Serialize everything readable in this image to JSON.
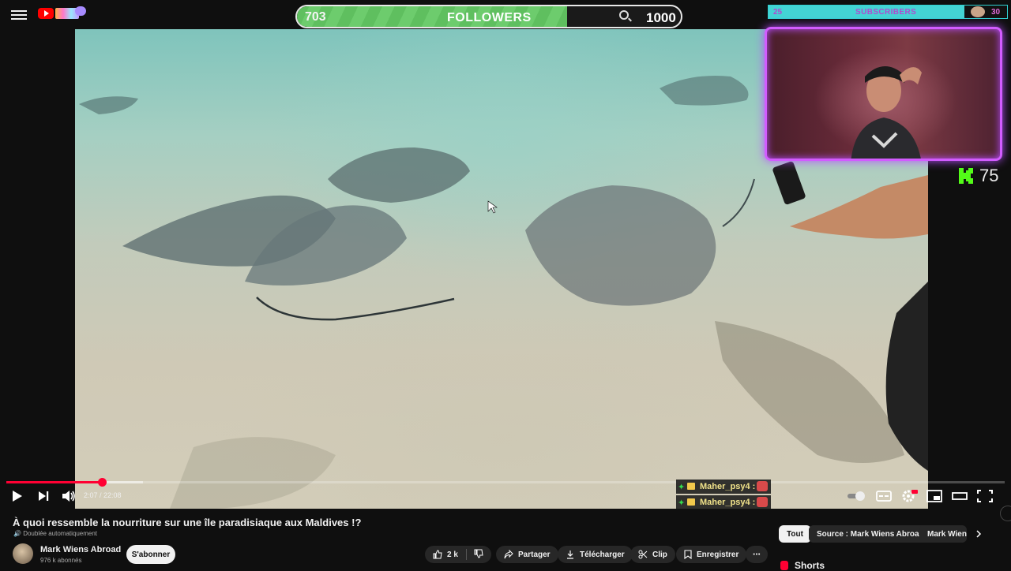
{
  "overlay": {
    "followers_current": "703",
    "followers_label": "FOLLOWERS",
    "followers_goal": "1000",
    "followers_progress_fraction": 0.703,
    "subscribers_current": "25",
    "subscribers_label": "SUBSCRIBERS",
    "subscribers_goal": "30",
    "kick_count": "75"
  },
  "player": {
    "time": "2:07 / 22:08",
    "progress_fraction": 0.096
  },
  "chat": [
    {
      "user": "Maher_psy4 :"
    },
    {
      "user": "Maher_psy4 :"
    }
  ],
  "video": {
    "title": "À quoi ressemble la nourriture sur une île paradisiaque aux Maldives !?",
    "dubbed": "Doublée automatiquement",
    "channel": "Mark Wiens Abroad",
    "subscribers": "976 k abonnés",
    "subscribe_label": "S'abonner",
    "likes": "2 k",
    "share": "Partager",
    "download": "Télécharger",
    "clip": "Clip",
    "save": "Enregistrer"
  },
  "chips": [
    "Tout",
    "Source : Mark Wiens Abroad",
    "Mark Wiens"
  ],
  "sidebar": {
    "shorts": "Shorts"
  },
  "colors": {
    "accent": "#ff0033",
    "followers_fill": "#5fbf5f",
    "subs_fill": "#43d4d4",
    "cam_border": "#d25cff",
    "kick": "#53fc18"
  }
}
